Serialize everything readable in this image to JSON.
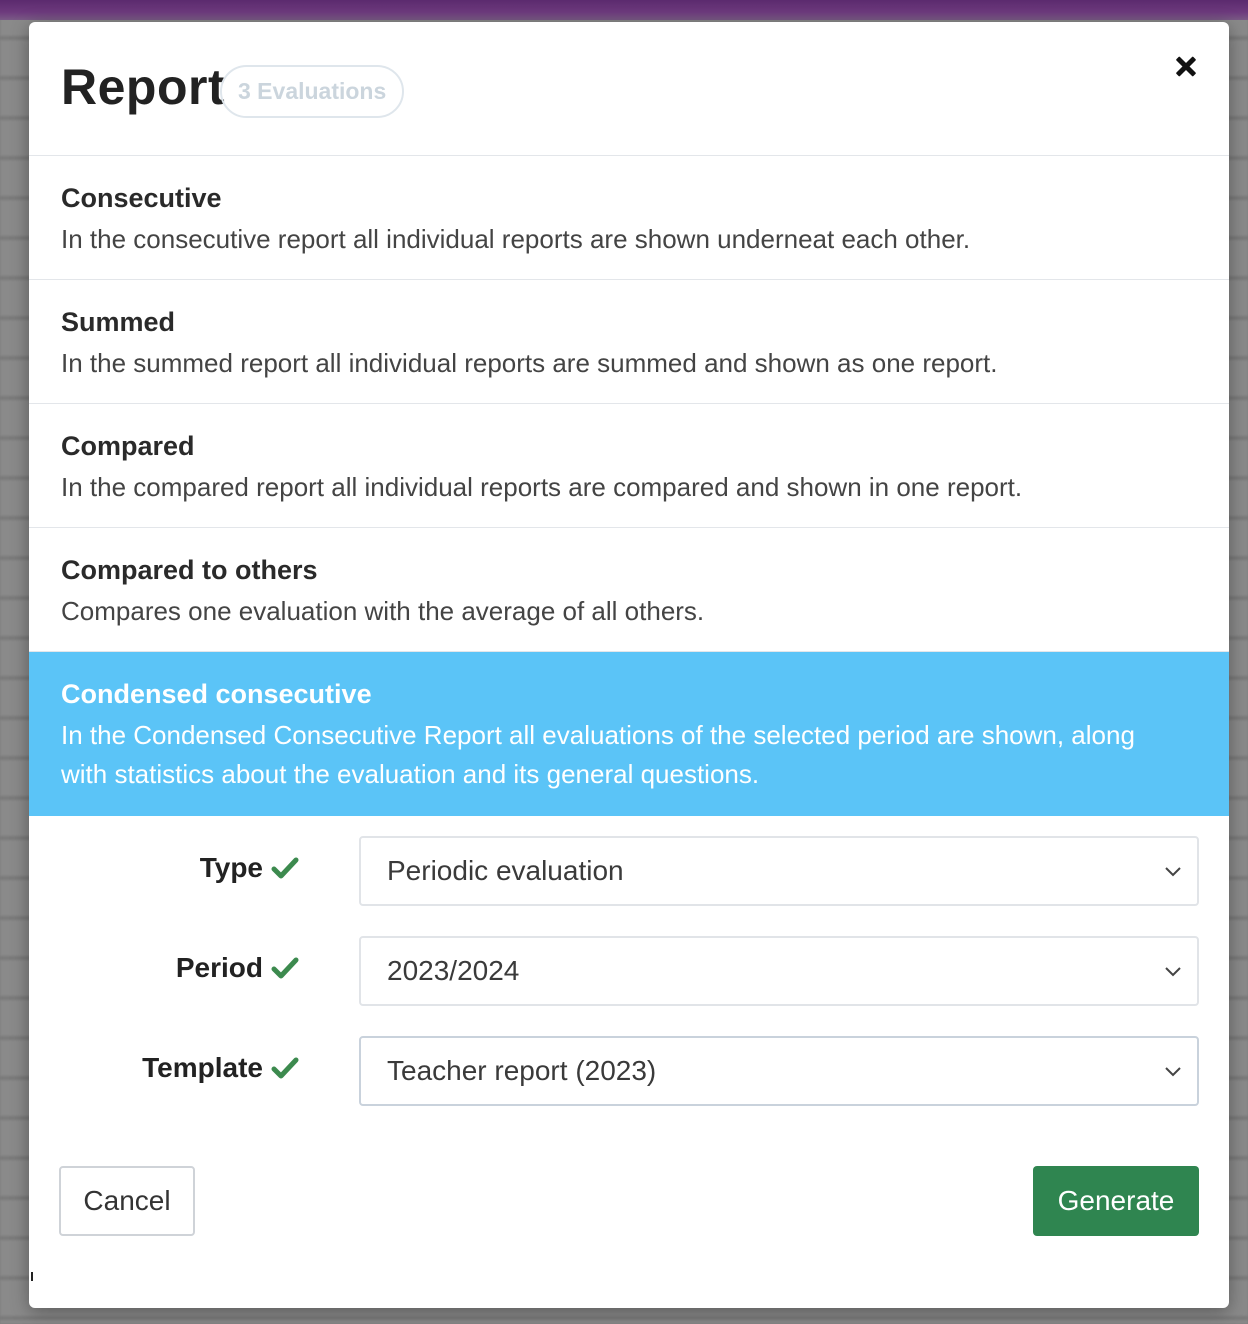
{
  "modal": {
    "title": "Report",
    "badge": "3 Evaluations",
    "close_icon": "close-icon"
  },
  "report_types": [
    {
      "title": "Consecutive",
      "description": "In the consecutive report all individual reports are shown underneat each other.",
      "selected": false
    },
    {
      "title": "Summed",
      "description": "In the summed report all individual reports are summed and shown as one report.",
      "selected": false
    },
    {
      "title": "Compared",
      "description": "In the compared report all individual reports are compared and shown in one report.",
      "selected": false
    },
    {
      "title": "Compared to others",
      "description": "Compares one evaluation with the average of all others.",
      "selected": false
    },
    {
      "title": "Condensed consecutive",
      "description": "In the Condensed Consecutive Report all evaluations of the selected period are shown, along with statistics about the evaluation and its general questions.",
      "selected": true
    }
  ],
  "form": {
    "type": {
      "label": "Type",
      "value": "Periodic evaluation",
      "valid": true
    },
    "period": {
      "label": "Period",
      "value": "2023/2024",
      "valid": true
    },
    "template": {
      "label": "Template",
      "value": "Teacher report (2023)",
      "valid": true
    }
  },
  "actions": {
    "cancel_label": "Cancel",
    "generate_label": "Generate"
  },
  "colors": {
    "selected_bg": "#5bc4f7",
    "generate_bg": "#2f8550",
    "check": "#3c8a4e",
    "header_bar": "#5b2a6e"
  }
}
